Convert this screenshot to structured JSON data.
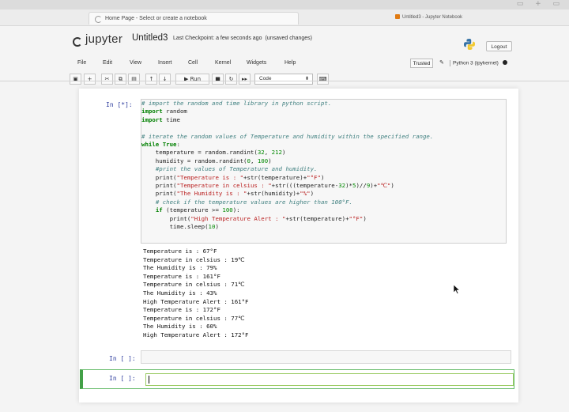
{
  "browser": {
    "active_tab_title": "Home Page - Select or create a notebook",
    "second_tab_title": "Untitled3 - Jupyter Notebook"
  },
  "header": {
    "logo_text": "jupyter",
    "notebook_name": "Untitled3",
    "checkpoint": "Last Checkpoint: a few seconds ago",
    "save_status": "(unsaved changes)",
    "logout_label": "Logout"
  },
  "menu": {
    "items": [
      "File",
      "Edit",
      "View",
      "Insert",
      "Cell",
      "Kernel",
      "Widgets",
      "Help"
    ],
    "trusted_label": "Trusted",
    "kernel_name": "Python 3 (ipykernel)"
  },
  "toolbar": {
    "run_label": "Run",
    "cell_type": "Code"
  },
  "cells": [
    {
      "prompt": "In [*]:",
      "source": "# import the random and time library in python script.\nimport random\nimport time\n\n# iterate the random values of Temperature and humidity within the specified range.\nwhile True:\n    temperature = random.randint(32, 212)\n    humidity = random.randint(0, 100)\n    #print the values of Temperature and humidity.\n    print(\"Temperature is : \"+str(temperature)+\"°F\")\n    print(\"Temperature in celsius : \"+str(((temperature-32)*5)//9)+\"℃\")\n    print(\"The Humidity is : \"+str(humidity)+\"%\")\n    # check if the temperature values are higher than 100°F.\n    if (temperature >= 100):\n        print(\"High Temperature Alert : \"+str(temperature)+\"°F\")\n        time.sleep(10)",
      "output": "Temperature is : 67°F\nTemperature in celsius : 19℃\nThe Humidity is : 79%\nTemperature is : 161°F\nTemperature in celsius : 71℃\nThe Humidity is : 43%\nHigh Temperature Alert : 161°F\nTemperature is : 172°F\nTemperature in celsius : 77℃\nThe Humidity is : 60%\nHigh Temperature Alert : 172°F"
    },
    {
      "prompt": "In [ ]:"
    },
    {
      "prompt": "In [ ]:"
    }
  ],
  "colors": {
    "prompt": "#303f9f",
    "selected_cell_border": "#42a047",
    "tab_favicon": "#e07a12"
  }
}
